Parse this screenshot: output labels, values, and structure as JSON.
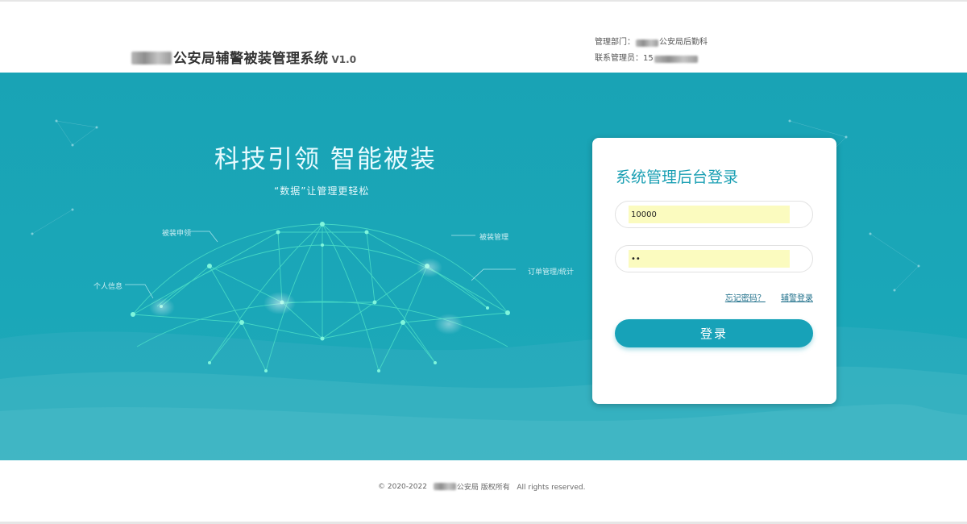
{
  "header": {
    "title": "公安局辅警被装管理系统",
    "version": "V1.0",
    "dept_label": "管理部门：",
    "dept_value": "公安局后勤科",
    "contact_label": "联系管理员：",
    "contact_value": "15"
  },
  "hero": {
    "slogan": "科技引领 智能被装",
    "sub_slogan": "“数据”让管理更轻松",
    "node_labels": [
      "被装申领",
      "被装管理",
      "订单管理/统计",
      "个人信息"
    ]
  },
  "login": {
    "title": "系统管理后台登录",
    "username_value": "10000",
    "password_value": "••",
    "forgot_link": "忘记密码？",
    "auxiliary_link": "辅警登录",
    "submit_label": "登录"
  },
  "footer": {
    "copyright_prefix": "© 2020-2022",
    "copyright_suffix": "公安局 版权所有   All rights reserved."
  },
  "colors": {
    "accent": "#17a2b8",
    "hero_bg": "#1aa7b8",
    "input_fill": "#fbfbbf"
  }
}
